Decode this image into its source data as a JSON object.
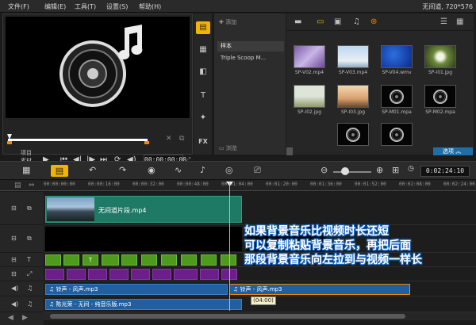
{
  "menu": {
    "items": [
      "文件(F)",
      "编辑(E)",
      "工具(T)",
      "设置(S)",
      "帮助(H)"
    ],
    "window_title": "无间道, 720*576"
  },
  "preview": {
    "label_project": "项目",
    "label_clip": "素材",
    "timecode": "00:00:00:00",
    "transport": [
      "play",
      "home",
      "prev-frame",
      "next-frame",
      "end",
      "repeat",
      "volume"
    ]
  },
  "library": {
    "add_label": "添加",
    "folders": [
      "样本",
      "Triple Scoop M..."
    ],
    "browse_label": "浏览",
    "options_label": "选项",
    "media": [
      {
        "name": "SP-V02.mp4",
        "kind": "video-purple"
      },
      {
        "name": "SP-V03.mp4",
        "kind": "video-sky"
      },
      {
        "name": "SP-V04.wmv",
        "kind": "video-blue"
      },
      {
        "name": "SP-I01.jpg",
        "kind": "image-dandelion"
      },
      {
        "name": "SP-I02.jpg",
        "kind": "image-field"
      },
      {
        "name": "SP-I03.jpg",
        "kind": "image-tree"
      },
      {
        "name": "SP-M01.mpa",
        "kind": "audio"
      },
      {
        "name": "SP-M02.mpa",
        "kind": "audio"
      },
      {
        "name": "",
        "kind": "audio"
      },
      {
        "name": "",
        "kind": "audio"
      }
    ]
  },
  "timeline": {
    "timecode": "0:02:24:10",
    "ruler": [
      "00:00:00:00",
      "00:00:16:00",
      "00:00:32:00",
      "00:00:48:00",
      "00:01:04:00",
      "00:01:20:00",
      "00:01:36:00",
      "00:01:52:00",
      "00:02:08:00",
      "00:02:24:00"
    ],
    "video_clip": "无间道片段.mp4",
    "audio_clip_1": "铃声 - 风声.mp3",
    "audio_clip_1_copy": "铃声 - 风声.mp3",
    "audio_clip_2": "陈光荣 - 无间 - 纯音乐版.mp3",
    "tooltip": "(04:00)"
  },
  "annotation": {
    "lines": [
      "如果背景音乐比视频时长还短",
      "可以复制粘贴背景音乐，再把后面",
      "那段背景音乐向左拉到与视频一样长"
    ]
  }
}
